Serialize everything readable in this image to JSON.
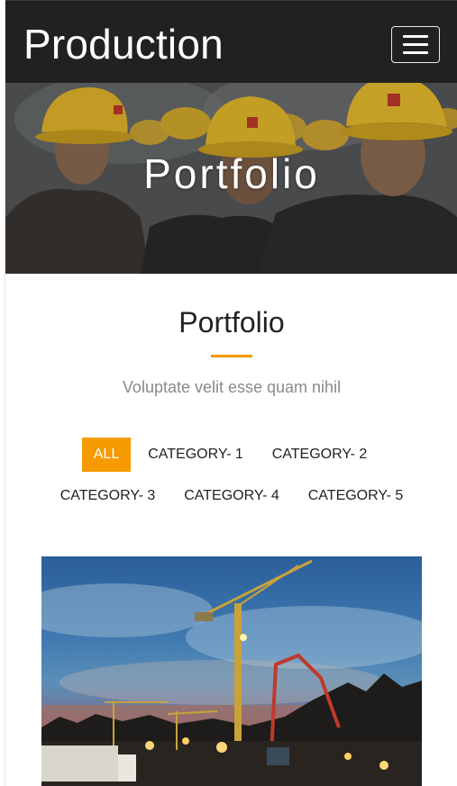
{
  "navbar": {
    "brand": "Production",
    "menu_icon": "hamburger-menu-icon"
  },
  "hero": {
    "title": "Portfolio"
  },
  "section": {
    "title": "Portfolio",
    "subtitle": "Voluptate velit esse quam nihil"
  },
  "filters": {
    "row1": [
      "ALL",
      "CATEGORY- 1",
      "CATEGORY- 2"
    ],
    "row2": [
      "CATEGORY- 3",
      "CATEGORY- 4",
      "CATEGORY- 5"
    ],
    "active": "ALL"
  },
  "colors": {
    "navbar_bg": "#232120",
    "accent": "#f59a00",
    "subtitle": "#8a8a8a"
  }
}
